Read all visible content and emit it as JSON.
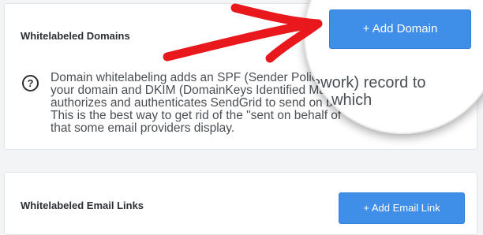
{
  "domains_section": {
    "title": "Whitelabeled Domains",
    "help_icon": "question-mark-circle-icon",
    "help_glyph": "?",
    "description": "Domain whitelabeling adds an SPF (Sender Policy Framework) record to your domain and DKIM (DomainKeys Identified Mail) keys, which effectively authorizes and authenticates SendGrid to send on behalf of your domain. This is the best way to get rid of the \"sent on behalf of\" or \"via\" message that some email providers display.",
    "add_button_label": "+ Add Domain"
  },
  "magnifier": {
    "line1": "ework) record to",
    "line2": "s, which"
  },
  "annotation": {
    "arrow_icon": "red-arrow-icon",
    "color": "#e8181c"
  },
  "links_section": {
    "title": "Whitelabeled Email Links",
    "add_button_label": "+ Add Email Link"
  },
  "colors": {
    "accent": "#3f8ee8",
    "page_background": "#f3f4f6"
  }
}
